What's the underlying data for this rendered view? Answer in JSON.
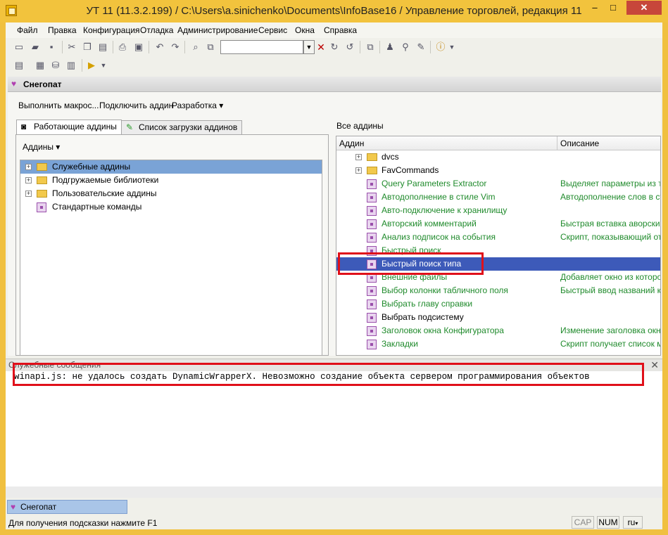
{
  "window": {
    "title": "УТ 11 (11.3.2.199) / C:\\Users\\a.sinichenko\\Documents\\InfoBase16 / Управление торговлей, редакция 11",
    "minimize": "–",
    "maximize": "□",
    "close": "✕"
  },
  "menu": [
    "Файл",
    "Правка",
    "Конфигурация",
    "Отладка",
    "Администрирование",
    "Сервис",
    "Окна",
    "Справка"
  ],
  "panel": {
    "title": "Снегопат",
    "commands": [
      "Выполнить макрос...",
      "Подключить аддин",
      "Разработка ▾"
    ],
    "tabs": [
      "Работающие аддины",
      "Список загрузки аддинов"
    ],
    "addins_label": "Аддины ▾",
    "left_tree": [
      "Служебные аддины",
      "Подгружаемые библиотеки",
      "Пользовательские аддины",
      "Стандартные команды"
    ],
    "all_addins_label": "Все аддины",
    "columns": [
      "Аддин",
      "Описание"
    ],
    "rows": [
      {
        "name": "dvcs",
        "desc": ""
      },
      {
        "name": "FavCommands",
        "desc": ""
      },
      {
        "name": "Query Parameters Extractor",
        "desc": "Выделяет параметры из текста"
      },
      {
        "name": "Автодополнение в стиле Vim",
        "desc": "Автодополнение слов в стиле"
      },
      {
        "name": "Авто-подключение к хранилищу",
        "desc": ""
      },
      {
        "name": "Авторский комментарий",
        "desc": "Быстрая вставка аворских ко"
      },
      {
        "name": "Анализ подписок на события",
        "desc": "Скрипт, показывающий отчет"
      },
      {
        "name": "Быстрый поиск",
        "desc": ""
      },
      {
        "name": "Быстрый поиск типа",
        "desc": ""
      },
      {
        "name": "Внешние файлы",
        "desc": "Добавляет окно из которого"
      },
      {
        "name": "Выбор колонки табличного поля",
        "desc": "Быстрый ввод названий колон"
      },
      {
        "name": "Выбрать главу справки",
        "desc": ""
      },
      {
        "name": "Выбрать подсистему",
        "desc": ""
      },
      {
        "name": "Заголовок окна Конфигуратора",
        "desc": "Изменение заголовка окна"
      },
      {
        "name": "Закладки",
        "desc": "Скрипт получает список мето"
      }
    ]
  },
  "messages": {
    "title": "Служебные сообщения",
    "close": "✕",
    "text": "winapi.js: не удалось создать DynamicWrapperX. Невозможно создание объекта сервером программирования объектов"
  },
  "taskbar": {
    "item": "Снегопат"
  },
  "status": {
    "hint": "Для получения подсказки нажмите F1",
    "caps": "CAP",
    "num": "NUM",
    "lang": "ru"
  }
}
